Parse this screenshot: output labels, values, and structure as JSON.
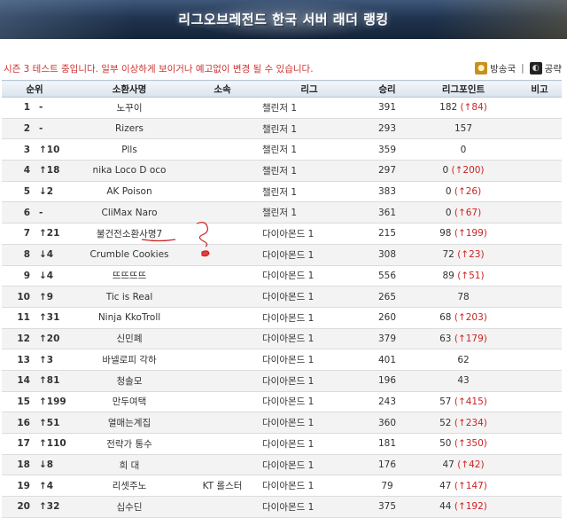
{
  "banner": {
    "title": "리그오브레전드 한국 서버 래더 랭킹"
  },
  "notice": "시즌 3 테스트 중입니다. 일부 이상하게 보이거나 예고없이 변경 될 수 있습니다.",
  "links": [
    {
      "label": "방송국",
      "icon": "broadcast-icon"
    },
    {
      "label": "공략",
      "icon": "guide-icon"
    }
  ],
  "link_separator": "|",
  "table": {
    "headers": [
      "순위",
      "소환사명",
      "소속",
      "리그",
      "승리",
      "리그포인트",
      "비고"
    ],
    "rows": [
      {
        "rank": "1",
        "dir": "same",
        "change": "-",
        "name": "노꾸이",
        "team": "",
        "league": "챌린저 1",
        "wins": "391",
        "lp": "182",
        "delta": "(↑84)"
      },
      {
        "rank": "2",
        "dir": "same",
        "change": "-",
        "name": "Rizers",
        "team": "",
        "league": "챌린저 1",
        "wins": "293",
        "lp": "157",
        "delta": ""
      },
      {
        "rank": "3",
        "dir": "up",
        "change": "↑10",
        "name": "Plls",
        "team": "",
        "league": "챌린저 1",
        "wins": "359",
        "lp": "0",
        "delta": ""
      },
      {
        "rank": "4",
        "dir": "up",
        "change": "↑18",
        "name": "nika Loco D oco",
        "team": "",
        "league": "챌린저 1",
        "wins": "297",
        "lp": "0",
        "delta": "(↑200)"
      },
      {
        "rank": "5",
        "dir": "down",
        "change": "↓2",
        "name": "AK Poison",
        "team": "",
        "league": "챌린저 1",
        "wins": "383",
        "lp": "0",
        "delta": "(↑26)"
      },
      {
        "rank": "6",
        "dir": "same",
        "change": "-",
        "name": "CliMax Naro",
        "team": "",
        "league": "챌린저 1",
        "wins": "361",
        "lp": "0",
        "delta": "(↑67)"
      },
      {
        "rank": "7",
        "dir": "up",
        "change": "↑21",
        "name": "불건전소환사명7",
        "team": "",
        "league": "다이아몬드 1",
        "wins": "215",
        "lp": "98",
        "delta": "(↑199)"
      },
      {
        "rank": "8",
        "dir": "down",
        "change": "↓4",
        "name": "Crumble Cookies",
        "team": "",
        "league": "다이아몬드 1",
        "wins": "308",
        "lp": "72",
        "delta": "(↑23)"
      },
      {
        "rank": "9",
        "dir": "down",
        "change": "↓4",
        "name": "뜨뜨뜨뜨",
        "team": "",
        "league": "다이아몬드 1",
        "wins": "556",
        "lp": "89",
        "delta": "(↑51)"
      },
      {
        "rank": "10",
        "dir": "up",
        "change": "↑9",
        "name": "Tic is Real",
        "team": "",
        "league": "다이아몬드 1",
        "wins": "265",
        "lp": "78",
        "delta": ""
      },
      {
        "rank": "11",
        "dir": "up",
        "change": "↑31",
        "name": "Ninja KkoTroll",
        "team": "",
        "league": "다이아몬드 1",
        "wins": "260",
        "lp": "68",
        "delta": "(↑203)"
      },
      {
        "rank": "12",
        "dir": "up",
        "change": "↑20",
        "name": "신민폐",
        "team": "",
        "league": "다이아몬드 1",
        "wins": "379",
        "lp": "63",
        "delta": "(↑179)"
      },
      {
        "rank": "13",
        "dir": "up",
        "change": "↑3",
        "name": "바넬로피 각하",
        "team": "",
        "league": "다이아몬드 1",
        "wins": "401",
        "lp": "62",
        "delta": ""
      },
      {
        "rank": "14",
        "dir": "up",
        "change": "↑81",
        "name": "청솔모",
        "team": "",
        "league": "다이아몬드 1",
        "wins": "196",
        "lp": "43",
        "delta": ""
      },
      {
        "rank": "15",
        "dir": "up",
        "change": "↑199",
        "name": "만두여택",
        "team": "",
        "league": "다이아몬드 1",
        "wins": "243",
        "lp": "57",
        "delta": "(↑415)"
      },
      {
        "rank": "16",
        "dir": "up",
        "change": "↑51",
        "name": "열매는계집",
        "team": "",
        "league": "다이아몬드 1",
        "wins": "360",
        "lp": "52",
        "delta": "(↑234)"
      },
      {
        "rank": "17",
        "dir": "up",
        "change": "↑110",
        "name": "전략가 통수",
        "team": "",
        "league": "다이아몬드 1",
        "wins": "181",
        "lp": "50",
        "delta": "(↑350)"
      },
      {
        "rank": "18",
        "dir": "down",
        "change": "↓8",
        "name": "희 대",
        "team": "",
        "league": "다이아몬드 1",
        "wins": "176",
        "lp": "47",
        "delta": "(↑42)"
      },
      {
        "rank": "19",
        "dir": "up",
        "change": "↑4",
        "name": "리셋주노",
        "team": "KT 롤스터",
        "league": "다이아몬드 1",
        "wins": "79",
        "lp": "47",
        "delta": "(↑147)"
      },
      {
        "rank": "20",
        "dir": "up",
        "change": "↑32",
        "name": "십수딘",
        "team": "",
        "league": "다이아몬드 1",
        "wins": "375",
        "lp": "44",
        "delta": "(↑192)"
      }
    ]
  },
  "colors": {
    "up": "#cc2222",
    "down": "#1f4fb0",
    "wins": "#3d8a2a",
    "notice": "#cc3333"
  }
}
